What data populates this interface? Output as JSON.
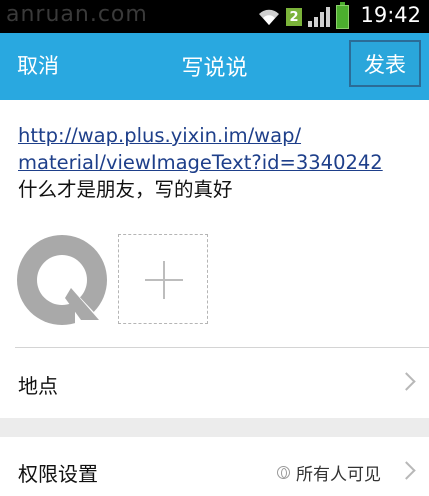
{
  "status_bar": {
    "watermark": "anruan.com",
    "notification_badge": "2",
    "time": "19:42",
    "icons": [
      "wifi-icon",
      "signal-icon",
      "battery-icon"
    ]
  },
  "titlebar": {
    "cancel_label": "取消",
    "title": "写说说",
    "publish_label": "发表",
    "color": "#29a8e0"
  },
  "compose": {
    "link_line1": "http://wap.plus.yixin.im/wap/",
    "link_line2": "material/viewImageText?id=3340242",
    "text": "什么才是朋友，写的真好"
  },
  "location": {
    "label": "地点"
  },
  "permissions": {
    "label": "权限设置",
    "value": "所有人可见"
  }
}
